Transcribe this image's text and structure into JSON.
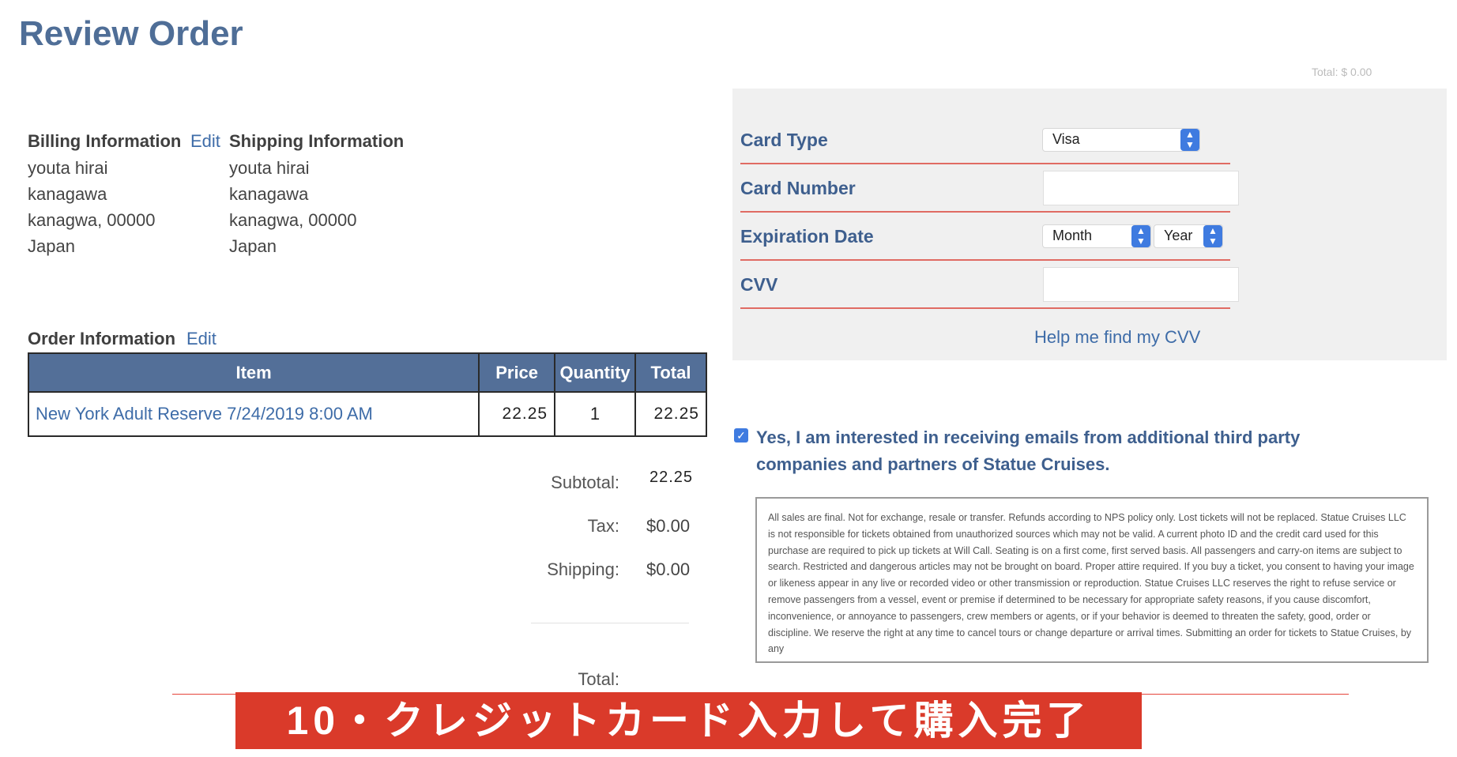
{
  "page": {
    "title": "Review Order"
  },
  "billing": {
    "label": "Billing Information",
    "edit": "Edit",
    "lines": [
      "youta hirai",
      "kanagawa",
      "kanagwa, 00000",
      "Japan"
    ]
  },
  "shipping": {
    "label": "Shipping Information",
    "lines": [
      "youta hirai",
      "kanagawa",
      "kanagwa, 00000",
      "Japan"
    ]
  },
  "order": {
    "label": "Order Information",
    "edit": "Edit",
    "columns": [
      "Item",
      "Price",
      "Quantity",
      "Total"
    ],
    "rows": [
      {
        "item": "New York Adult Reserve 7/24/2019 8:00 AM",
        "price": "22.25",
        "quantity": "1",
        "total": "22.25"
      }
    ]
  },
  "totals": {
    "subtotal_label": "Subtotal:",
    "subtotal": "22.25",
    "tax_label": "Tax:",
    "tax": "$0.00",
    "shipping_label": "Shipping:",
    "shipping": "$0.00",
    "total_label": "Total:"
  },
  "payment": {
    "card_type_label": "Card Type",
    "card_type_value": "Visa",
    "card_number_label": "Card Number",
    "expiration_label": "Expiration Date",
    "month_value": "Month",
    "year_value": "Year",
    "cvv_label": "CVV",
    "cvv_help": "Help me find my CVV",
    "faint_total": "Total:  $ 0.00"
  },
  "optin": {
    "checked": true,
    "text": "Yes, I am interested in receiving emails from additional third party companies and partners of Statue Cruises."
  },
  "terms": {
    "text": "All sales are final. Not for exchange, resale or transfer. Refunds according to NPS policy only. Lost tickets will not be replaced. Statue Cruises LLC is not responsible for tickets obtained from unauthorized sources which may not be valid. A current photo ID and the credit card used for this purchase are required to pick up tickets at Will Call. Seating is on a first come, first served basis. All passengers and carry-on items are subject to search. Restricted and dangerous articles may not be brought on board. Proper attire required. If you buy a ticket, you consent to having your image or likeness appear in any live or recorded video or other transmission or reproduction. Statue Cruises LLC reserves the right to refuse service or remove passengers from a vessel, event or premise if determined to be necessary for appropriate safety reasons, if you cause discomfort, inconvenience, or annoyance to passengers, crew members or agents, or if your behavior is deemed to threaten the safety, good, order or discipline. We reserve the right at any time to cancel tours or change departure or arrival times. Submitting an order for tickets to Statue Cruises, by any"
  },
  "banner": {
    "text": "10・クレジットカード入力して購入完了"
  },
  "colors": {
    "accent": "#536f98",
    "link": "#3e6ca8",
    "banner": "#da3a2a",
    "field_underline": "#e06b63"
  }
}
